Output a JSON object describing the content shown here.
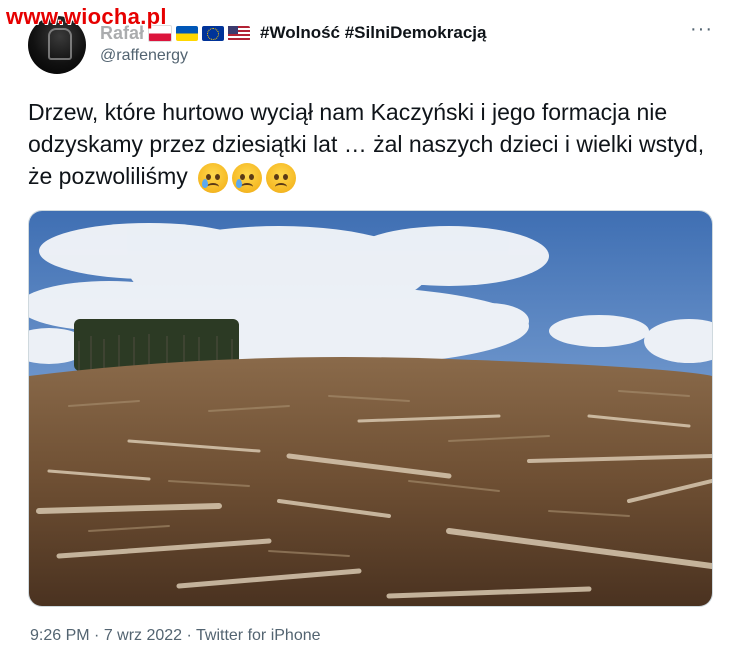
{
  "watermark": "www.wiocha.pl",
  "author": {
    "name": "Rafał",
    "hashtags": "#Wolność #SilniDemokracją",
    "handle": "@raffenergy",
    "flags": [
      "pl-flag",
      "ua-flag",
      "eu-flag",
      "us-flag"
    ]
  },
  "menu": {
    "more_label": "···"
  },
  "tweet": {
    "text": "Drzew, które hurtowo wyciął nam Kaczyński i jego formacja nie odzyskamy przez dziesiątki lat … żal naszych dzieci i wielki wstyd, że pozwoliliśmy",
    "emojis": [
      "crying-face-emoji",
      "crying-face-emoji",
      "crying-face-emoji"
    ]
  },
  "media": {
    "icon": "photo-clearcut-forest"
  },
  "meta": {
    "time": "9:26 PM",
    "sep1": " · ",
    "date": "7 wrz 2022",
    "sep2": " · ",
    "client": "Twitter for iPhone"
  }
}
